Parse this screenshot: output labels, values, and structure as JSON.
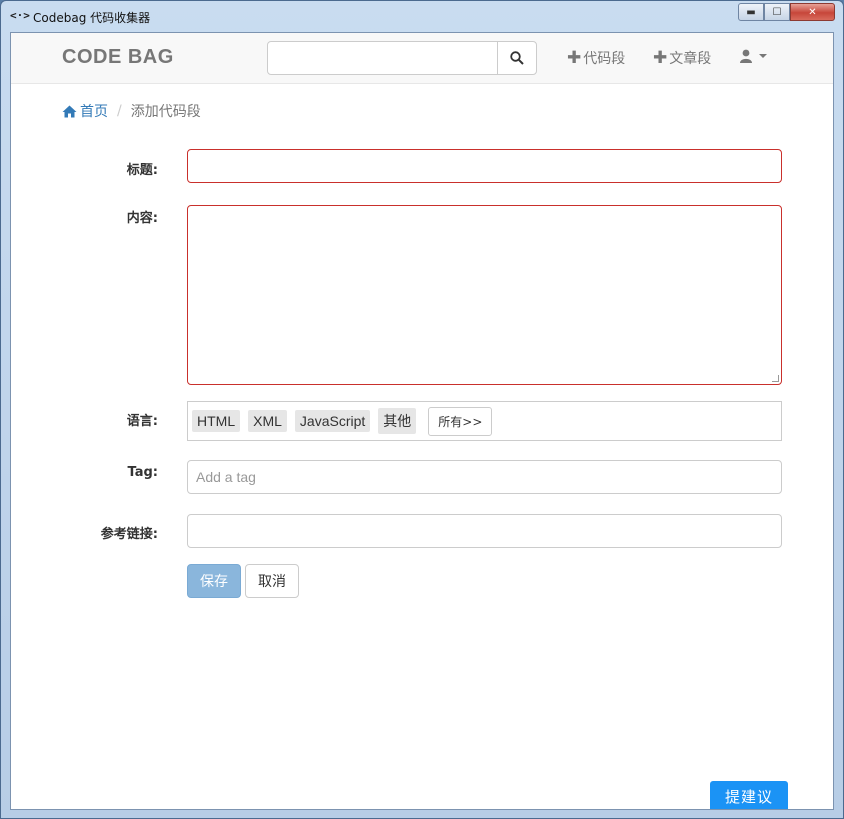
{
  "window": {
    "title": "Codebag 代码收集器",
    "icon_glyph": "<·>",
    "controls": {
      "minimize": "▬",
      "maximize": "☐",
      "close": "✕"
    }
  },
  "navbar": {
    "brand": "CODE BAG",
    "search": {
      "value": "",
      "placeholder": ""
    },
    "add_snippet": "代码段",
    "add_article": "文章段",
    "icons": {
      "search": "search-icon",
      "plus": "plus-icon",
      "user": "user-icon"
    }
  },
  "breadcrumb": {
    "home": "首页",
    "separator": "/",
    "current": "添加代码段"
  },
  "form": {
    "title_label": "标题:",
    "title_value": "",
    "content_label": "内容:",
    "content_value": "",
    "language_label": "语言:",
    "languages": [
      "HTML",
      "XML",
      "JavaScript",
      "其他"
    ],
    "languages_all": "所有>>",
    "tag_label": "Tag:",
    "tag_placeholder": "Add a tag",
    "link_label": "参考链接:",
    "link_value": "",
    "save": "保存",
    "cancel": "取消"
  },
  "feedback": "提建议",
  "colors": {
    "link": "#337ab7",
    "error_border": "#c9302c",
    "save_button": "#8ab6dc",
    "feedback": "#1b93f5"
  }
}
